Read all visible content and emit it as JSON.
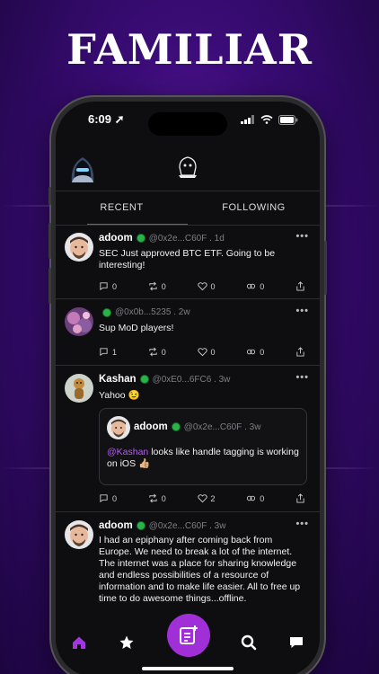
{
  "hero": {
    "title": "FAMILIAR"
  },
  "status_bar": {
    "time": "6:09"
  },
  "tabs": [
    {
      "label": "RECENT",
      "active": true
    },
    {
      "label": "FOLLOWING",
      "active": false
    }
  ],
  "accent_color": "#a436e0",
  "posts": [
    {
      "name": "adoom",
      "handle": "@0x2e...C60F . 1d",
      "text": "SEC Just approved BTC ETF. Going to be interesting!",
      "comments": "0",
      "reposts": "0",
      "likes": "0",
      "tips": "0"
    },
    {
      "name": "",
      "handle": "@0x0b...5235 . 2w",
      "text": "Sup MoD players!",
      "comments": "1",
      "reposts": "0",
      "likes": "0",
      "tips": "0"
    },
    {
      "name": "Kashan",
      "handle": "@0xE0...6FC6 . 3w",
      "text": "Yahoo 😉",
      "quote": {
        "name": "adoom",
        "handle": "@0x2e...C60F . 3w",
        "mention": "@Kashan",
        "text": " looks like handle tagging is working on iOS 👍🏼"
      },
      "comments": "0",
      "reposts": "0",
      "likes": "2",
      "tips": "0"
    },
    {
      "name": "adoom",
      "handle": "@0x2e...C60F . 3w",
      "text": "I had an epiphany after coming back from Europe. We need to break a lot of the internet. The internet was a place for sharing knowledge and endless possibilities of a resource of information and to make life easier. All to free up time to do awesome things...offline."
    }
  ],
  "bottom_nav": [
    "home-icon",
    "star-icon",
    "compose-icon",
    "search-icon",
    "chat-icon"
  ]
}
